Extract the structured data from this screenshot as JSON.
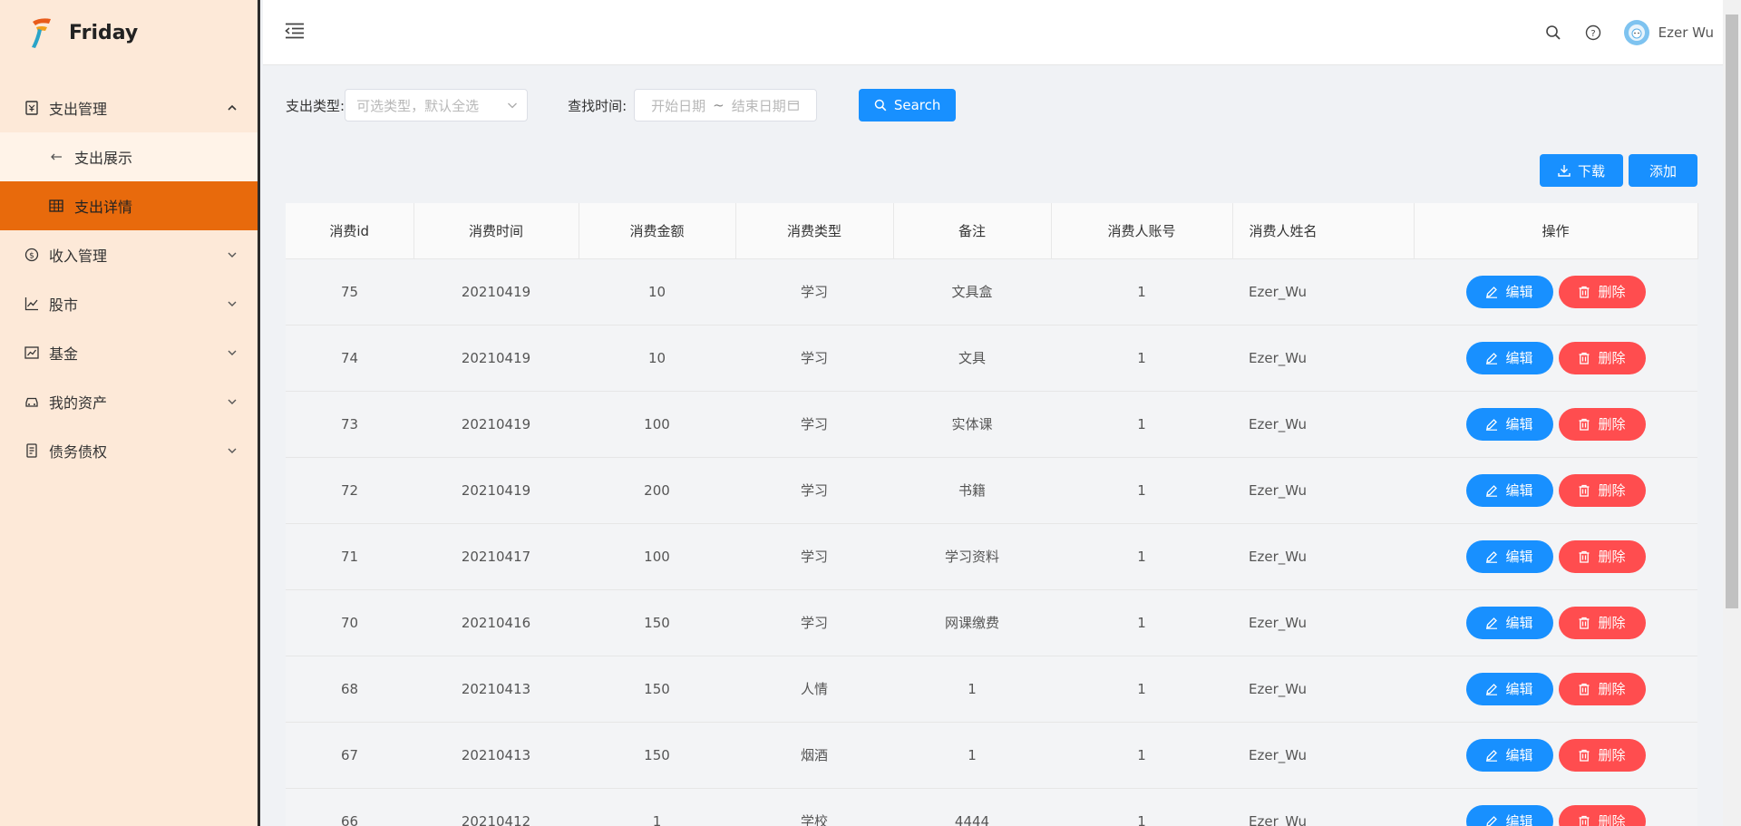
{
  "app": {
    "name": "Friday"
  },
  "sidebar": {
    "groups": [
      {
        "label": "支出管理",
        "icon": "receipt-icon",
        "open": true,
        "children": [
          {
            "label": "支出展示",
            "icon": "back-arrow-icon",
            "active": false
          },
          {
            "label": "支出详情",
            "icon": "table-icon",
            "active": true
          }
        ]
      },
      {
        "label": "收入管理",
        "icon": "coin-icon"
      },
      {
        "label": "股市",
        "icon": "line-chart-icon"
      },
      {
        "label": "基金",
        "icon": "stock-chart-icon"
      },
      {
        "label": "我的资产",
        "icon": "car-icon"
      },
      {
        "label": "债务债权",
        "icon": "document-icon"
      }
    ]
  },
  "header": {
    "user_name": "Ezer Wu"
  },
  "filters": {
    "type_label": "支出类型:",
    "type_placeholder": "可选类型，默认全选",
    "time_label": "查找时间:",
    "start_placeholder": "开始日期",
    "range_sep": "~",
    "end_placeholder": "结束日期",
    "search_label": "Search"
  },
  "toolbar": {
    "download_label": "下载",
    "add_label": "添加"
  },
  "table": {
    "columns": [
      "消费id",
      "消费时间",
      "消费金额",
      "消费类型",
      "备注",
      "消费人账号",
      "消费人姓名",
      "操作"
    ],
    "edit_label": "编辑",
    "delete_label": "删除",
    "rows": [
      [
        "75",
        "20210419",
        "10",
        "学习",
        "文具盒",
        "1",
        "Ezer_Wu"
      ],
      [
        "74",
        "20210419",
        "10",
        "学习",
        "文具",
        "1",
        "Ezer_Wu"
      ],
      [
        "73",
        "20210419",
        "100",
        "学习",
        "实体课",
        "1",
        "Ezer_Wu"
      ],
      [
        "72",
        "20210419",
        "200",
        "学习",
        "书籍",
        "1",
        "Ezer_Wu"
      ],
      [
        "71",
        "20210417",
        "100",
        "学习",
        "学习资料",
        "1",
        "Ezer_Wu"
      ],
      [
        "70",
        "20210416",
        "150",
        "学习",
        "网课缴费",
        "1",
        "Ezer_Wu"
      ],
      [
        "68",
        "20210413",
        "150",
        "人情",
        "1",
        "1",
        "Ezer_Wu"
      ],
      [
        "67",
        "20210413",
        "150",
        "烟酒",
        "1",
        "1",
        "Ezer_Wu"
      ],
      [
        "66",
        "20210412",
        "1",
        "学校",
        "4444",
        "1",
        "Ezer_Wu"
      ]
    ]
  },
  "colors": {
    "primary": "#1890ff",
    "danger": "#ff4d4f",
    "accent": "#e86a0c",
    "sidebar_bg": "#fde9d8"
  }
}
